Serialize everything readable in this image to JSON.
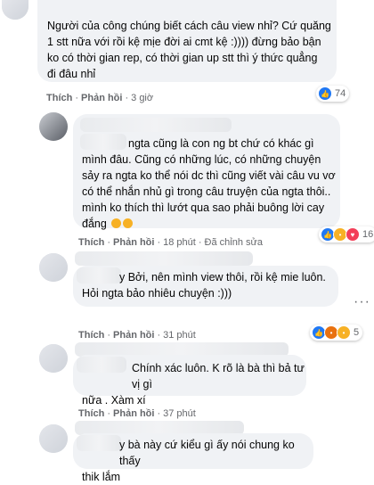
{
  "comments": [
    {
      "lines": [
        "Người của công chúng biết cách câu view nhỉ? Cứ quăng",
        "1 stt nữa với rồi kệ mịe đời ai cmt kệ :)))) đừng bảo bận",
        "ko có thời gian rep, có thời gian up stt thì ý thức quẳng",
        "đi đâu nhỉ"
      ],
      "like": "Thích",
      "reply": "Phản hồi",
      "time": "3 giờ",
      "reaction_count": "74"
    },
    {
      "lines": [
        "ngta cũng là con ng bt chứ có khác gì",
        "mình đâu. Cũng có những lúc, có những chuyện",
        "sảy ra ngta ko thể nói dc thì cũng viết vài câu vu vơ",
        "có thể nhắn nhủ gì trong câu truyện của ngta thôi..",
        "mình ko thích thì lướt qua sao phải buông lời cay",
        "đắng"
      ],
      "like": "Thích",
      "reply": "Phản hồi",
      "time": "18 phút",
      "edited": "Đã chỉnh sửa",
      "reaction_count": "16"
    },
    {
      "lines": [
        "y Bởi, nên mình view thôi, rồi kệ mie luôn.",
        "Hỏi ngta bảo nhiêu chuyện :)))"
      ],
      "like": "Thích",
      "reply": "Phản hồi",
      "time": "31 phút",
      "reaction_count": "5"
    },
    {
      "lines": [
        "Chính xác luôn. K rõ là bà thì bả tư vị gì",
        "nữa . Xàm xí"
      ],
      "like": "Thích",
      "reply": "Phản hồi",
      "time": "37 phút"
    },
    {
      "lines": [
        "y bà này cứ kiểu gì ấy nói chung ko thấy",
        "thik lắm"
      ]
    }
  ],
  "icons": [
    "like-icon",
    "sad-icon",
    "love-icon",
    "angry-icon",
    "more-options-icon"
  ]
}
